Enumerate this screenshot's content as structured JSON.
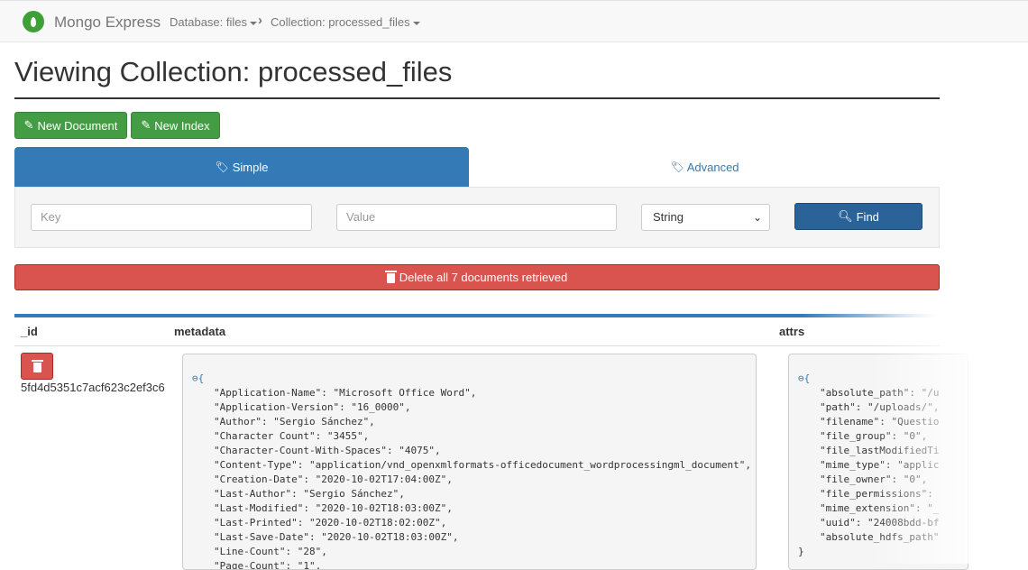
{
  "navbar": {
    "brand": "Mongo Express",
    "database_crumb": "Database: files",
    "collection_crumb": "Collection: processed_files"
  },
  "page": {
    "title": "Viewing Collection: processed_files"
  },
  "actions": {
    "new_document": "New Document",
    "new_index": "New Index",
    "delete_all": "Delete all 7 documents retrieved"
  },
  "tabs": {
    "simple": "Simple",
    "advanced": "Advanced"
  },
  "search": {
    "key_placeholder": "Key",
    "value_placeholder": "Value",
    "type_selected": "String",
    "find_label": "Find"
  },
  "table": {
    "columns": [
      "_id",
      "metadata",
      "attrs"
    ],
    "rows": [
      {
        "id": "5fd4d5351c7acf623c2ef3c6",
        "metadata_open": "⊖{",
        "metadata": [
          "\"Application-Name\": \"Microsoft Office Word\",",
          "\"Application-Version\": \"16_0000\",",
          "\"Author\": \"Sergio Sánchez\",",
          "\"Character Count\": \"3455\",",
          "\"Character-Count-With-Spaces\": \"4075\",",
          "\"Content-Type\": \"application/vnd_openxmlformats-officedocument_wordprocessingml_document\",",
          "\"Creation-Date\": \"2020-10-02T17:04:00Z\",",
          "\"Last-Author\": \"Sergio Sánchez\",",
          "\"Last-Modified\": \"2020-10-02T18:03:00Z\",",
          "\"Last-Printed\": \"2020-10-02T18:02:00Z\",",
          "\"Last-Save-Date\": \"2020-10-02T18:03:00Z\",",
          "\"Line-Count\": \"28\",",
          "\"Page-Count\": \"1\","
        ],
        "attrs_open": "⊖{",
        "attrs": [
          "\"absolute_path\": \"/u",
          "\"path\": \"/uploads/\",",
          "\"filename\": \"Questio",
          "\"file_group\": \"0\",",
          "\"file_lastModifiedTi",
          "\"mime_type\": \"applic",
          "\"file_owner\": \"0\",",
          "\"file_permissions\":",
          "\"mime_extension\": \"_",
          "\"uuid\": \"24008bdd-bf",
          "\"absolute_hdfs_path\""
        ],
        "attrs_close": "}"
      }
    ]
  }
}
